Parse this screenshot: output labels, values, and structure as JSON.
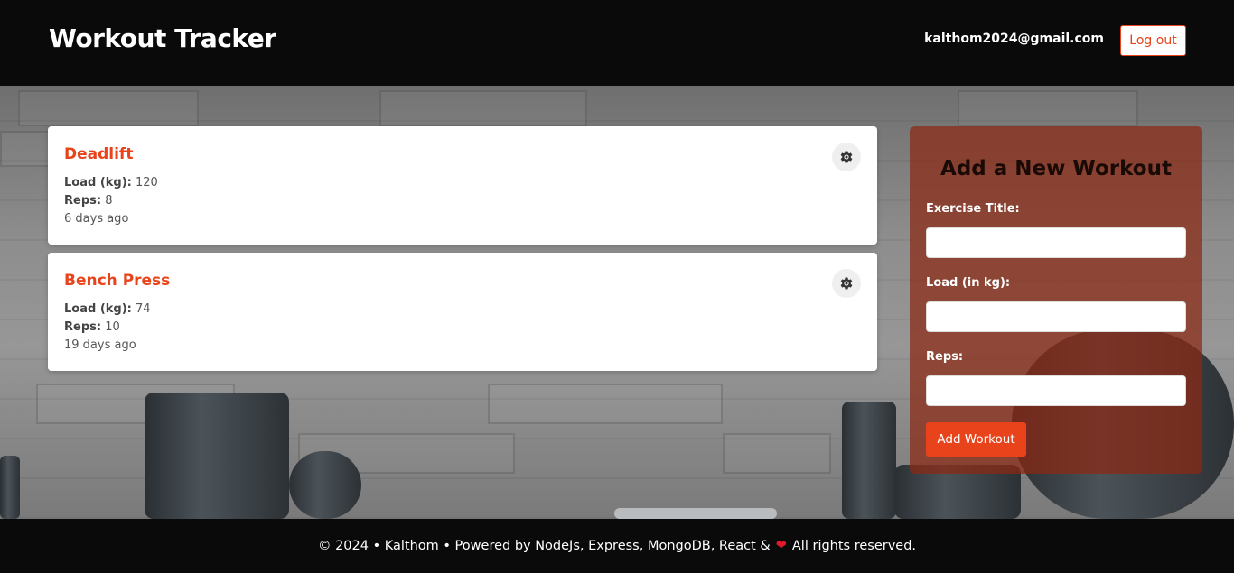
{
  "header": {
    "brand": "Workout Tracker",
    "user_email": "kalthom2024@gmail.com",
    "logout_label": "Log out"
  },
  "workouts": [
    {
      "title": "Deadlift",
      "load_label": "Load (kg):",
      "load": "120",
      "reps_label": "Reps:",
      "reps": "8",
      "date": "6 days ago"
    },
    {
      "title": "Bench Press",
      "load_label": "Load (kg):",
      "load": "74",
      "reps_label": "Reps:",
      "reps": "10",
      "date": "19 days ago"
    }
  ],
  "form": {
    "title": "Add a New Workout",
    "exercise_label": "Exercise Title:",
    "exercise_value": "",
    "load_label": "Load (in kg):",
    "load_value": "",
    "reps_label": "Reps:",
    "reps_value": "",
    "submit_label": "Add Workout"
  },
  "footer": {
    "text_before": "© 2024 • Kalthom • Powered by NodeJs, Express, MongoDB, React &",
    "heart": "❤",
    "text_after": "All rights reserved."
  },
  "colors": {
    "accent": "#e8431a",
    "header_bg": "#0a0a0a",
    "form_panel": "#8c2814"
  },
  "icons": {
    "settings": "gear-icon"
  }
}
